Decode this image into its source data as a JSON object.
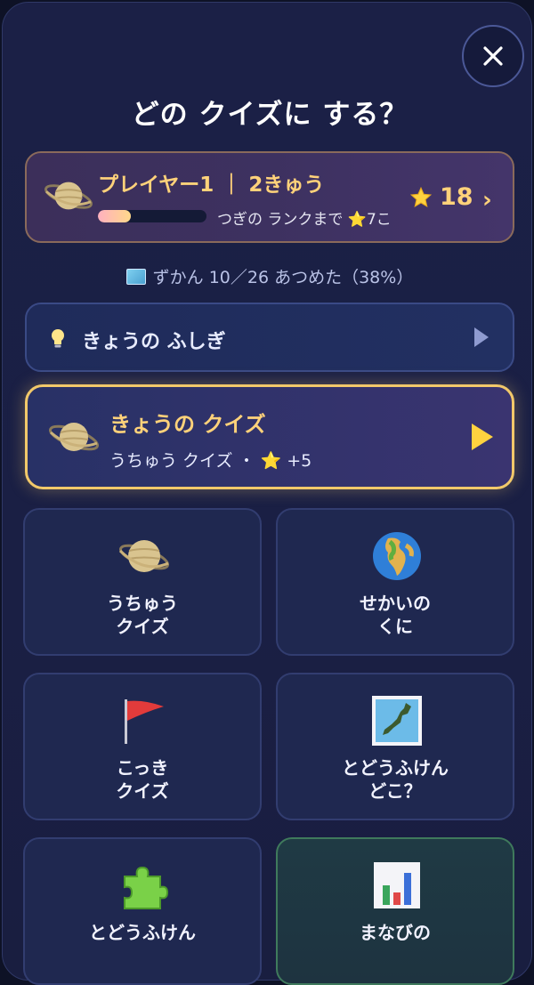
{
  "header": {
    "title": "どの クイズに する？",
    "close_label": "×"
  },
  "player": {
    "name_rank": "プレイヤー1 ｜ 2きゅう",
    "progress_fraction": 0.3,
    "next_rank_text": "つぎの ランクまで ⭐7こ",
    "stars": "18",
    "chevron": "›"
  },
  "collection": {
    "text": "ずかん 10／26 あつめた（38%）"
  },
  "wonder": {
    "label": "きょうの ふしぎ"
  },
  "daily_quiz": {
    "title": "きょうの クイズ",
    "subtitle": "うちゅう クイズ ・ ⭐ +5"
  },
  "tiles": [
    {
      "label": "うちゅう\nクイズ",
      "icon": "saturn-icon"
    },
    {
      "label": "せかいの\nくに",
      "icon": "globe-icon"
    },
    {
      "label": "こっき\nクイズ",
      "icon": "flag-icon"
    },
    {
      "label": "とどうふけん\nどこ？",
      "icon": "japan-map-icon"
    },
    {
      "label": "とどうふけん",
      "icon": "puzzle-icon"
    },
    {
      "label": "まなびの",
      "icon": "bar-chart-icon"
    }
  ],
  "colors": {
    "accent_gold": "#ffd27a",
    "card_border_gold": "#f2c96a",
    "background": "#1b2046"
  }
}
